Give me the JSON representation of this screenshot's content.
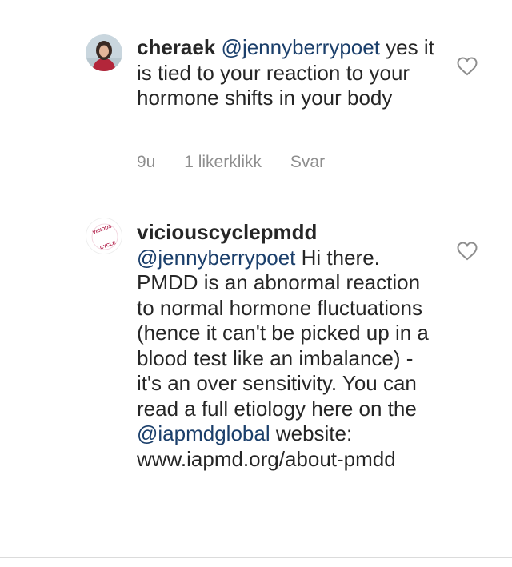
{
  "comments": [
    {
      "username": "cheraek",
      "mention": "@jennyberrypoet",
      "body_after_mention": " yes it is tied to your reaction to your hormone shifts in your body",
      "age": "9u",
      "likes": "1 likerklikk",
      "reply_label": "Svar",
      "avatar_icon": "profile-photo-woman-red-dress",
      "like_icon": "heart-outline-icon"
    },
    {
      "username": "viciouscyclepmdd",
      "mention": "@jennyberrypoet",
      "body_part1": " Hi there. PMDD is an abnormal reaction to normal hormone fluctuations (hence it can't be picked up in a blood test like an imbalance) - it's an over sensitivity. You can read a full etiology here on the ",
      "mention2": "@iapmdglobal",
      "body_part2": " website: www.iapmd.org/about-pmdd",
      "avatar_text": "VICIOUS CYCLE",
      "avatar_icon": "vicious-cycle-logo",
      "like_icon": "heart-outline-icon"
    }
  ],
  "colors": {
    "mention": "#1b3f6b",
    "meta": "#8e8e8e",
    "text": "#262626"
  }
}
